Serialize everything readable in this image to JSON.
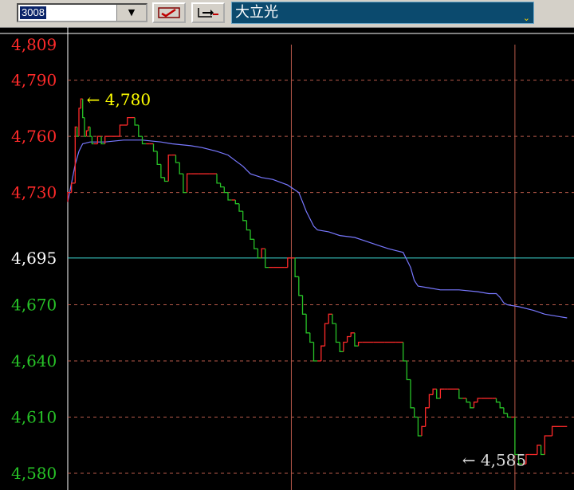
{
  "toolbar": {
    "stock_code": "3008",
    "dropdown_icon": "chevron-down-icon",
    "edit_icon": "pencil-check-icon",
    "export_icon": "export-arrow-icon"
  },
  "stock": {
    "name": "大立光"
  },
  "colors": {
    "up": "#ff2a2a",
    "down": "#27c227",
    "avg": "#7878ff",
    "ref": "#39c6c0",
    "grid": "#b85a4a",
    "high_label": "#ffff00",
    "low_label": "#dcdcdc",
    "ref_label": "#ffffff"
  },
  "chart_data": {
    "type": "line",
    "title": "",
    "y_ticks": [
      {
        "value": 4809,
        "label": "4,809",
        "class": "up"
      },
      {
        "value": 4790,
        "label": "4,790",
        "class": "up"
      },
      {
        "value": 4760,
        "label": "4,760",
        "class": "up"
      },
      {
        "value": 4730,
        "label": "4,730",
        "class": "up"
      },
      {
        "value": 4695,
        "label": "4,695",
        "class": "ref"
      },
      {
        "value": 4670,
        "label": "4,670",
        "class": "down"
      },
      {
        "value": 4640,
        "label": "4,640",
        "class": "down"
      },
      {
        "value": 4610,
        "label": "4,610",
        "class": "down"
      },
      {
        "value": 4580,
        "label": "4,580",
        "class": "down"
      }
    ],
    "ylim": [
      4580,
      4809
    ],
    "reference_price": 4695,
    "x_range": [
      0,
      270
    ],
    "x_gridlines": [
      0,
      120,
      240
    ],
    "high": {
      "label": "← 4,780",
      "value": 4780,
      "x": 5
    },
    "low": {
      "label": "← 4,585",
      "value": 4585,
      "x": 204
    },
    "price_series": [
      [
        0,
        4725
      ],
      [
        2,
        4730
      ],
      [
        4,
        4735
      ],
      [
        5,
        4765
      ],
      [
        6,
        4760
      ],
      [
        7,
        4775
      ],
      [
        8,
        4780
      ],
      [
        9,
        4770
      ],
      [
        10,
        4760
      ],
      [
        11,
        4763
      ],
      [
        12,
        4765
      ],
      [
        13,
        4760
      ],
      [
        14,
        4756
      ],
      [
        16,
        4756
      ],
      [
        18,
        4760
      ],
      [
        20,
        4756
      ],
      [
        22,
        4760
      ],
      [
        28,
        4760
      ],
      [
        30,
        4766
      ],
      [
        32,
        4766
      ],
      [
        34,
        4770
      ],
      [
        36,
        4770
      ],
      [
        38,
        4766
      ],
      [
        40,
        4760
      ],
      [
        42,
        4756
      ],
      [
        44,
        4756
      ],
      [
        46,
        4756
      ],
      [
        48,
        4752
      ],
      [
        50,
        4745
      ],
      [
        52,
        4738
      ],
      [
        54,
        4736
      ],
      [
        56,
        4750
      ],
      [
        58,
        4750
      ],
      [
        60,
        4746
      ],
      [
        62,
        4740
      ],
      [
        64,
        4730
      ],
      [
        65,
        4740
      ],
      [
        66,
        4740
      ],
      [
        70,
        4740
      ],
      [
        76,
        4740
      ],
      [
        80,
        4740
      ],
      [
        82,
        4735
      ],
      [
        84,
        4733
      ],
      [
        86,
        4730
      ],
      [
        88,
        4726
      ],
      [
        90,
        4726
      ],
      [
        92,
        4724
      ],
      [
        94,
        4720
      ],
      [
        96,
        4715
      ],
      [
        98,
        4710
      ],
      [
        100,
        4705
      ],
      [
        102,
        4700
      ],
      [
        104,
        4695
      ],
      [
        106,
        4700
      ],
      [
        108,
        4690
      ],
      [
        110,
        4690
      ],
      [
        116,
        4690
      ],
      [
        118,
        4690
      ],
      [
        120,
        4695
      ],
      [
        122,
        4695
      ],
      [
        124,
        4685
      ],
      [
        126,
        4675
      ],
      [
        128,
        4665
      ],
      [
        130,
        4655
      ],
      [
        132,
        4650
      ],
      [
        134,
        4640
      ],
      [
        136,
        4640
      ],
      [
        138,
        4648
      ],
      [
        140,
        4660
      ],
      [
        142,
        4665
      ],
      [
        144,
        4660
      ],
      [
        146,
        4650
      ],
      [
        148,
        4645
      ],
      [
        150,
        4650
      ],
      [
        152,
        4653
      ],
      [
        154,
        4655
      ],
      [
        156,
        4648
      ],
      [
        158,
        4650
      ],
      [
        164,
        4650
      ],
      [
        170,
        4650
      ],
      [
        176,
        4650
      ],
      [
        180,
        4650
      ],
      [
        182,
        4640
      ],
      [
        184,
        4630
      ],
      [
        186,
        4615
      ],
      [
        188,
        4610
      ],
      [
        190,
        4600
      ],
      [
        192,
        4605
      ],
      [
        194,
        4615
      ],
      [
        196,
        4622
      ],
      [
        198,
        4625
      ],
      [
        200,
        4620
      ],
      [
        202,
        4625
      ],
      [
        204,
        4625
      ],
      [
        210,
        4625
      ],
      [
        212,
        4620
      ],
      [
        214,
        4620
      ],
      [
        216,
        4618
      ],
      [
        218,
        4615
      ],
      [
        220,
        4618
      ],
      [
        222,
        4620
      ],
      [
        228,
        4620
      ],
      [
        230,
        4620
      ],
      [
        232,
        4618
      ],
      [
        234,
        4615
      ],
      [
        236,
        4612
      ],
      [
        238,
        4610
      ],
      [
        240,
        4610
      ],
      [
        242,
        4590
      ],
      [
        244,
        4585
      ],
      [
        246,
        4585
      ],
      [
        248,
        4590
      ],
      [
        252,
        4590
      ],
      [
        254,
        4595
      ],
      [
        256,
        4590
      ],
      [
        258,
        4600
      ],
      [
        260,
        4600
      ],
      [
        264,
        4605
      ],
      [
        268,
        4605
      ]
    ],
    "avg_series": [
      [
        0,
        4725
      ],
      [
        2,
        4735
      ],
      [
        4,
        4745
      ],
      [
        6,
        4752
      ],
      [
        8,
        4756
      ],
      [
        12,
        4757
      ],
      [
        20,
        4757
      ],
      [
        30,
        4758
      ],
      [
        40,
        4758
      ],
      [
        50,
        4757
      ],
      [
        56,
        4756
      ],
      [
        66,
        4755
      ],
      [
        72,
        4754
      ],
      [
        80,
        4752
      ],
      [
        86,
        4750
      ],
      [
        90,
        4747
      ],
      [
        94,
        4744
      ],
      [
        98,
        4740
      ],
      [
        104,
        4738
      ],
      [
        110,
        4737
      ],
      [
        118,
        4734
      ],
      [
        124,
        4730
      ],
      [
        126,
        4725
      ],
      [
        128,
        4720
      ],
      [
        130,
        4716
      ],
      [
        132,
        4712
      ],
      [
        134,
        4710
      ],
      [
        140,
        4709
      ],
      [
        146,
        4707
      ],
      [
        154,
        4706
      ],
      [
        160,
        4704
      ],
      [
        166,
        4702
      ],
      [
        172,
        4700
      ],
      [
        176,
        4699
      ],
      [
        180,
        4698
      ],
      [
        184,
        4690
      ],
      [
        186,
        4683
      ],
      [
        188,
        4680
      ],
      [
        194,
        4679
      ],
      [
        200,
        4678
      ],
      [
        210,
        4678
      ],
      [
        220,
        4677
      ],
      [
        226,
        4676
      ],
      [
        230,
        4676
      ],
      [
        232,
        4674
      ],
      [
        234,
        4671
      ],
      [
        236,
        4670
      ],
      [
        242,
        4669
      ],
      [
        250,
        4667
      ],
      [
        256,
        4665
      ],
      [
        262,
        4664
      ],
      [
        268,
        4663
      ]
    ]
  }
}
